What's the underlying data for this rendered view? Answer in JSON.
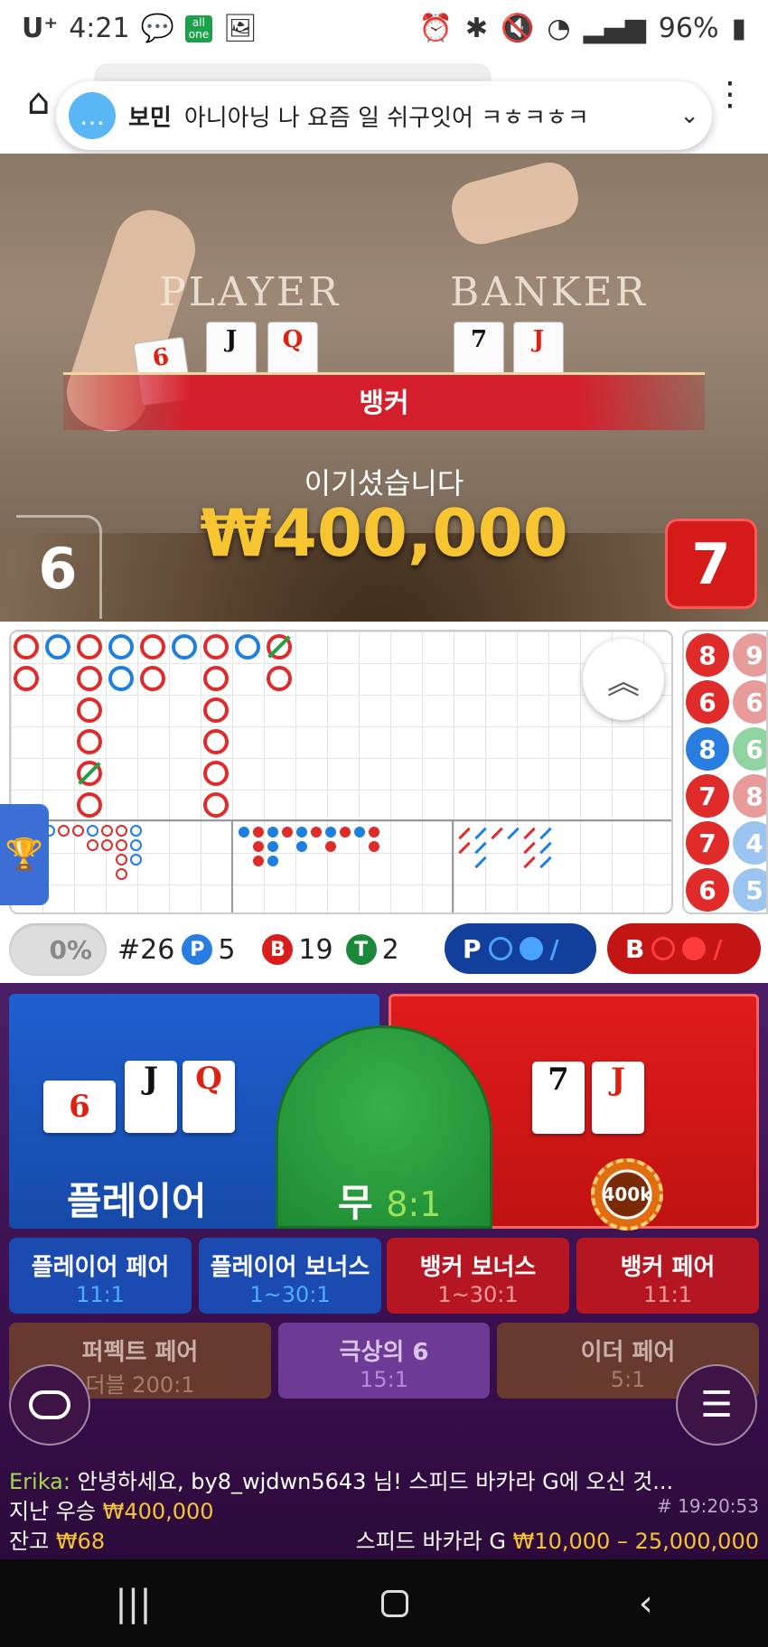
{
  "status_bar": {
    "carrier": "U⁺",
    "time": "4:21",
    "battery": "96%",
    "app_badge": "all one"
  },
  "notification": {
    "sender": "보민",
    "message": "아니아닝 나 요즘 일 쉬구잇어 ㅋㅎㅋㅎㅋ"
  },
  "video": {
    "player_label": "PLAYER",
    "banker_label": "BANKER",
    "player_cards": [
      "6",
      "J",
      "Q"
    ],
    "banker_cards": [
      "7",
      "J"
    ],
    "result_banner": "뱅커",
    "win_text": "이기셨습니다",
    "win_amount": "₩400,000",
    "player_score": "6",
    "banker_score": "7"
  },
  "side_road_numbers": [
    "8",
    "9",
    "6",
    "6",
    "8",
    "6",
    "7",
    "8",
    "7",
    "4",
    "6",
    "5"
  ],
  "stats": {
    "toggle_pct": "0%",
    "round": "#26",
    "p_label": "P",
    "p_count": "5",
    "b_label": "B",
    "b_count": "19",
    "t_label": "T",
    "t_count": "2",
    "p_predict_label": "P",
    "b_predict_label": "B"
  },
  "bets": {
    "player": "플레이어",
    "tie": "무",
    "tie_odds": "8:1",
    "chip": "400k",
    "player_pair": "플레이어 페어",
    "player_pair_odds": "11:1",
    "player_bonus": "플레이어 보너스",
    "player_bonus_odds": "1~30:1",
    "banker_bonus": "뱅커 보너스",
    "banker_bonus_odds": "1~30:1",
    "banker_pair": "뱅커 페어",
    "banker_pair_odds": "11:1",
    "perfect_pair": "퍼펙트 페어",
    "perfect_pair_odds": "더블 200:1",
    "super6": "극상의 6",
    "super6_odds": "15:1",
    "either_pair": "이더 페어",
    "either_pair_odds": "5:1"
  },
  "chat": {
    "name": "Erika:",
    "text": "안녕하세요, by8_wjdwn5643 님! 스피드 바카라 G에 오신 것..."
  },
  "info": {
    "last_win_label": "지난 우승",
    "last_win_amount": "₩400,000",
    "round_id": "# 19:20:53",
    "balance_label": "잔고",
    "balance": "₩68",
    "table_name": "스피드 바카라 G",
    "limits": "₩10,000 – 25,000,000"
  },
  "colors": {
    "player": "#1f5fd0",
    "banker": "#e01b1b",
    "tie": "#2e9e41",
    "gold": "#f6c531"
  }
}
